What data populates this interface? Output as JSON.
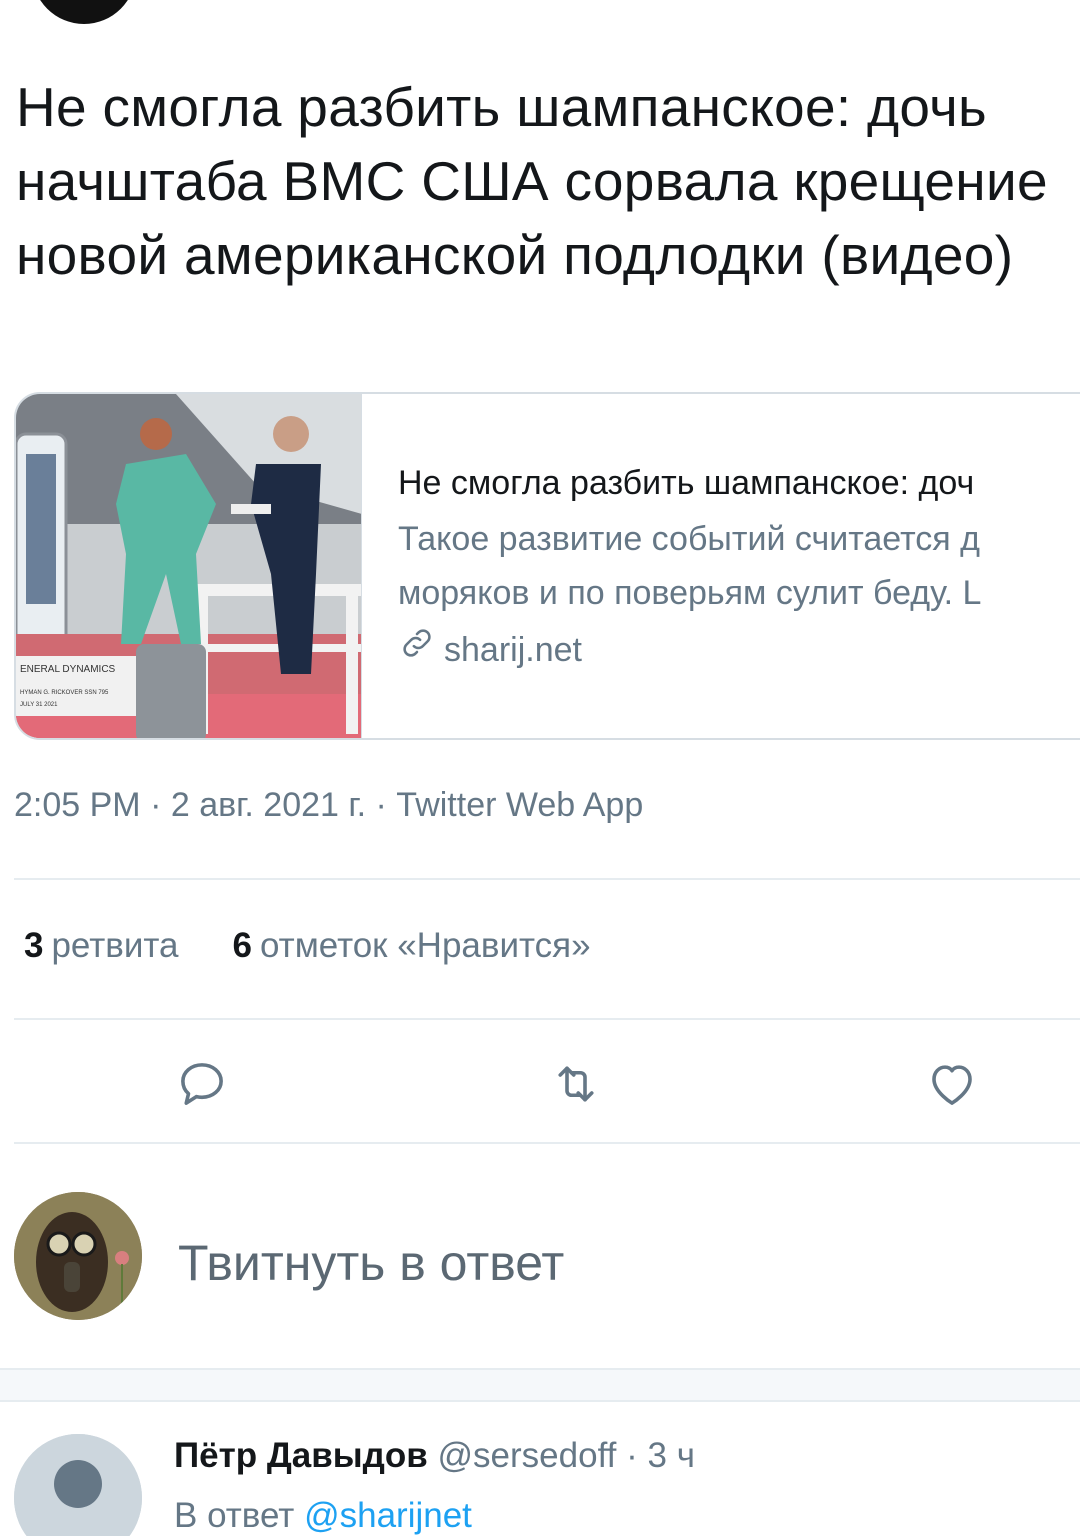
{
  "tweet": {
    "text": "Не смогла разбить шампанское: дочь начштаба ВМС США сорвала крещение новой американской подлодки (видео)",
    "card": {
      "title": "Не смогла разбить шампанское: доч",
      "description_line1": "Такое развитие событий считается д",
      "description_line2": "моряков и по поверьям сулит беду. L",
      "domain": "sharij.net"
    },
    "meta": "2:05 PM · 2 авг. 2021 г. · Twitter Web App",
    "stats": {
      "retweets_count": "3",
      "retweets_label": "ретвита",
      "likes_count": "6",
      "likes_label": "отметок «Нравится»"
    }
  },
  "actions": {
    "reply_icon": "reply-icon",
    "retweet_icon": "retweet-icon",
    "like_icon": "heart-icon"
  },
  "reply_composer": {
    "placeholder": "Твитнуть в ответ"
  },
  "reply_tweet": {
    "name": "Пётр Давыдов",
    "handle": "@sersedoff",
    "time": "· 3 ч",
    "reply_prefix": "В ответ",
    "reply_mention": "@sharijnet"
  },
  "colors": {
    "text_primary": "#14171a",
    "text_secondary": "#657786",
    "link_blue": "#1da1f2",
    "divider": "#e6ecf0"
  }
}
